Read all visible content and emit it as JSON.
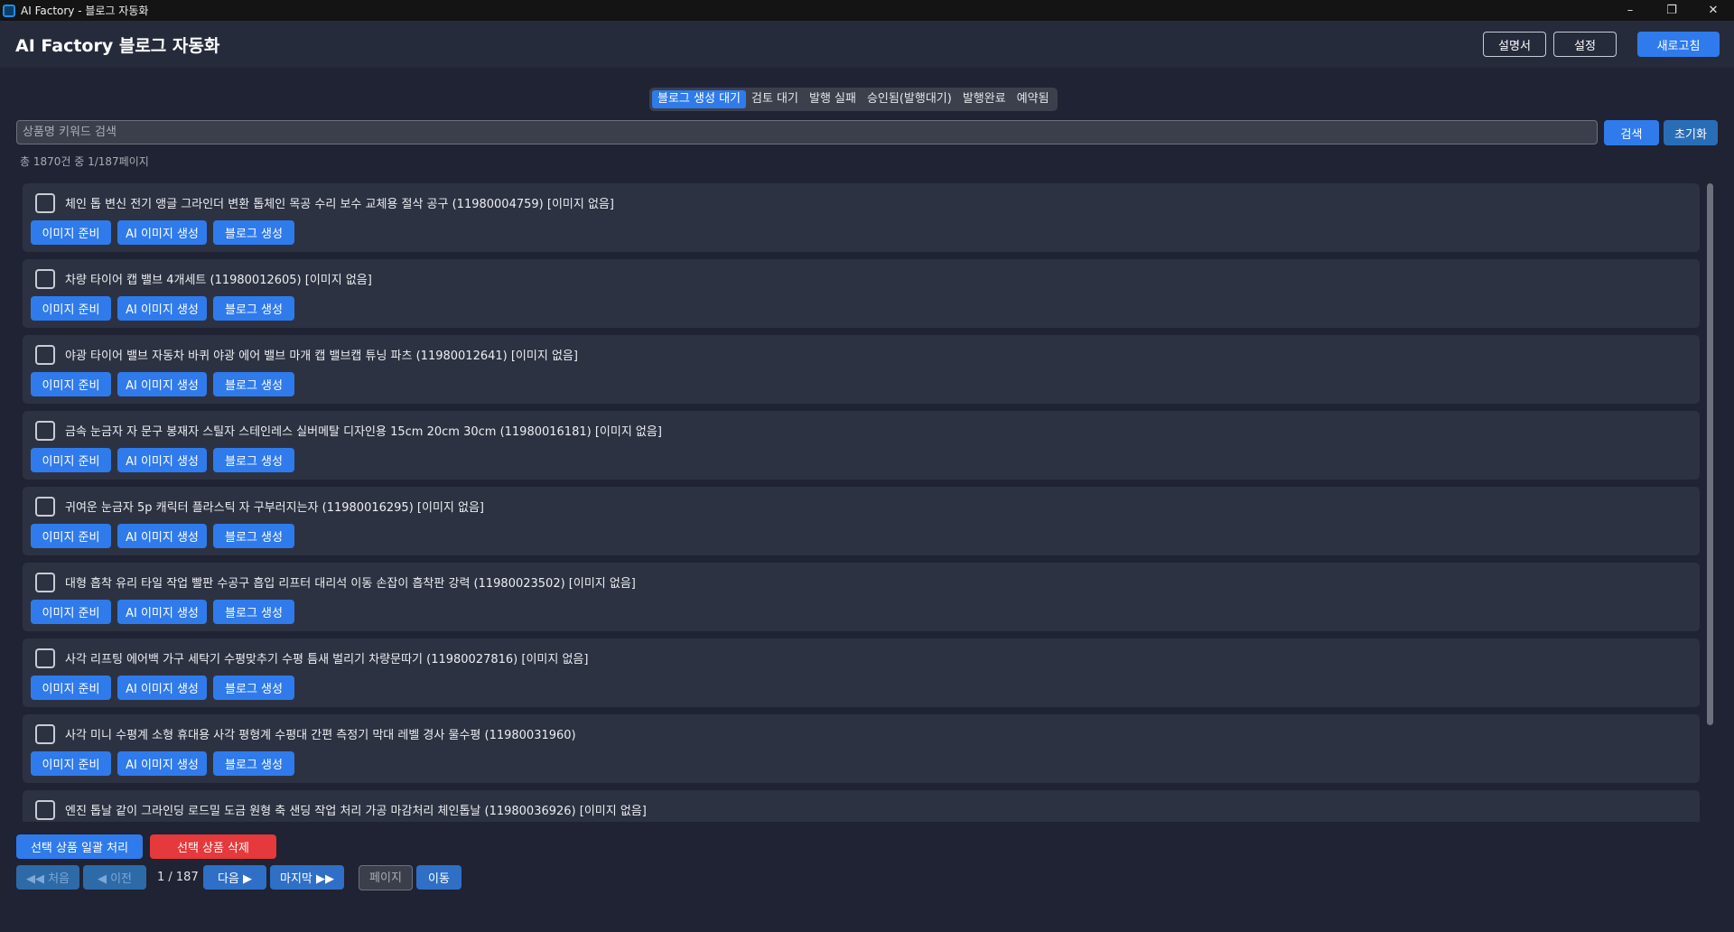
{
  "window": {
    "title": "AI Factory - 블로그 자동화",
    "minimize": "–",
    "maximize": "❐",
    "close": "✕"
  },
  "header": {
    "title": "AI Factory 블로그 자동화",
    "manual_label": "설명서",
    "settings_label": "설정",
    "refresh_label": "새로고침"
  },
  "tabs": [
    {
      "label": "블로그 생성 대기",
      "active": true
    },
    {
      "label": "검토 대기",
      "active": false
    },
    {
      "label": "발행 실패",
      "active": false
    },
    {
      "label": "승인됨(발행대기)",
      "active": false
    },
    {
      "label": "발행완료",
      "active": false
    },
    {
      "label": "예약됨",
      "active": false
    }
  ],
  "search": {
    "placeholder": "상품명 키워드 검색",
    "search_label": "검색",
    "reset_label": "초기화"
  },
  "count_text": "총 1870건 중 1/187페이지",
  "item_buttons": {
    "prepare": "이미지 준비",
    "ai_image": "AI 이미지 생성",
    "blog": "블로그 생성"
  },
  "items": [
    {
      "title": "체인 톱 변신 전기 앵글 그라인더 변환 톱체인 목공 수리 보수 교체용 절삭 공구 (11980004759)  [이미지 없음]"
    },
    {
      "title": "차량 타이어 캡 밸브 4개세트 (11980012605)  [이미지 없음]"
    },
    {
      "title": "야광 타이어 밸브 자동차 바퀴 야광 에어 밸브 마개 캡 밸브캡 튜닝 파츠 (11980012641)  [이미지 없음]"
    },
    {
      "title": "금속 눈금자 자 문구 봉재자 스틸자 스테인레스 실버메탈 디자인용 15cm 20cm 30cm (11980016181)  [이미지 없음]"
    },
    {
      "title": "귀여운 눈금자 5p 캐릭터 플라스틱 자 구부러지는자 (11980016295)  [이미지 없음]"
    },
    {
      "title": "대형 흡착 유리 타일 작업 빨판 수공구 흡입 리프터 대리석 이동 손잡이 흡착판 강력 (11980023502)  [이미지 없음]"
    },
    {
      "title": "사각 리프팅 에어백 가구 세탁기 수평맞추기 수평 틈새 벌리기 차량문따기 (11980027816)  [이미지 없음]"
    },
    {
      "title": "사각 미니 수평계 소형 휴대용 사각 평형계 수평대 간편 측정기 막대 레벨 경사 물수평 (11980031960)"
    },
    {
      "title": "엔진 톱날 같이 그라인딩 로드밀 도금 원형 축 샌딩 작업 처리 가공 마감처리 체인톱날 (11980036926)  [이미지 없음]"
    }
  ],
  "bottom": {
    "bulk_label": "선택 상품 일괄 처리",
    "delete_label": "선택 상품 삭제",
    "first_label": "◀◀ 처음",
    "prev_label": "◀ 이전",
    "page_indicator": "1 / 187",
    "next_label": "다음 ▶",
    "last_label": "마지막 ▶▶",
    "page_placeholder": "페이지",
    "go_label": "이동"
  }
}
